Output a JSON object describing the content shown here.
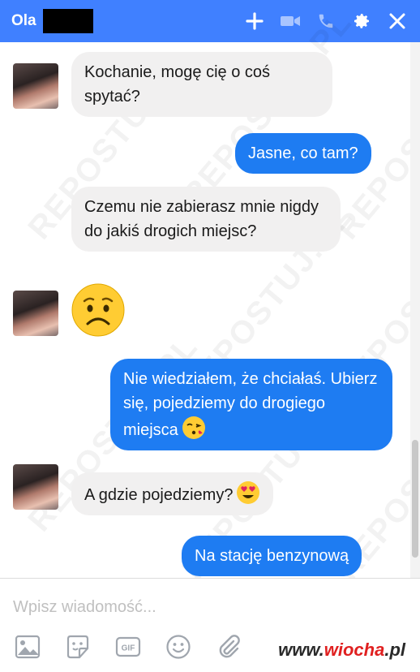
{
  "header": {
    "contact_name": "Ola",
    "icons": [
      "plus-icon",
      "video-icon",
      "phone-icon",
      "gear-icon",
      "close-icon"
    ],
    "color": "#4080ff"
  },
  "messages": [
    {
      "side": "in",
      "text": "Kochanie, mogę cię o coś spytać?"
    },
    {
      "side": "out",
      "text": "Jasne, co tam?"
    },
    {
      "side": "in",
      "text": "Czemu nie zabierasz mnie nigdy do jakiś drogich miejsc?"
    },
    {
      "side": "in",
      "emoji": "worried-face"
    },
    {
      "side": "out",
      "text": "Nie wiedziałem, że chciałaś. Ubierz się, pojedziemy do drogiego miejsca",
      "emoji": "kissing-face"
    },
    {
      "side": "in",
      "text": "A gdzie pojedziemy?",
      "emoji": "heart-eyes-face"
    },
    {
      "side": "out",
      "text": "Na stację benzynową"
    }
  ],
  "composer": {
    "placeholder": "Wpisz wiadomość...",
    "tools": [
      "image-icon",
      "sticker-icon",
      "gif-icon",
      "emoji-icon",
      "attachment-icon"
    ],
    "gif_label": "GIF"
  },
  "watermark": {
    "text": "REPOSTUJ.PL"
  },
  "brand": {
    "prefix": "www.",
    "name": "wiocha",
    "suffix": ".pl"
  },
  "colors": {
    "outgoing_bubble": "#1e7cf2",
    "incoming_bubble": "#f1f0f0"
  }
}
